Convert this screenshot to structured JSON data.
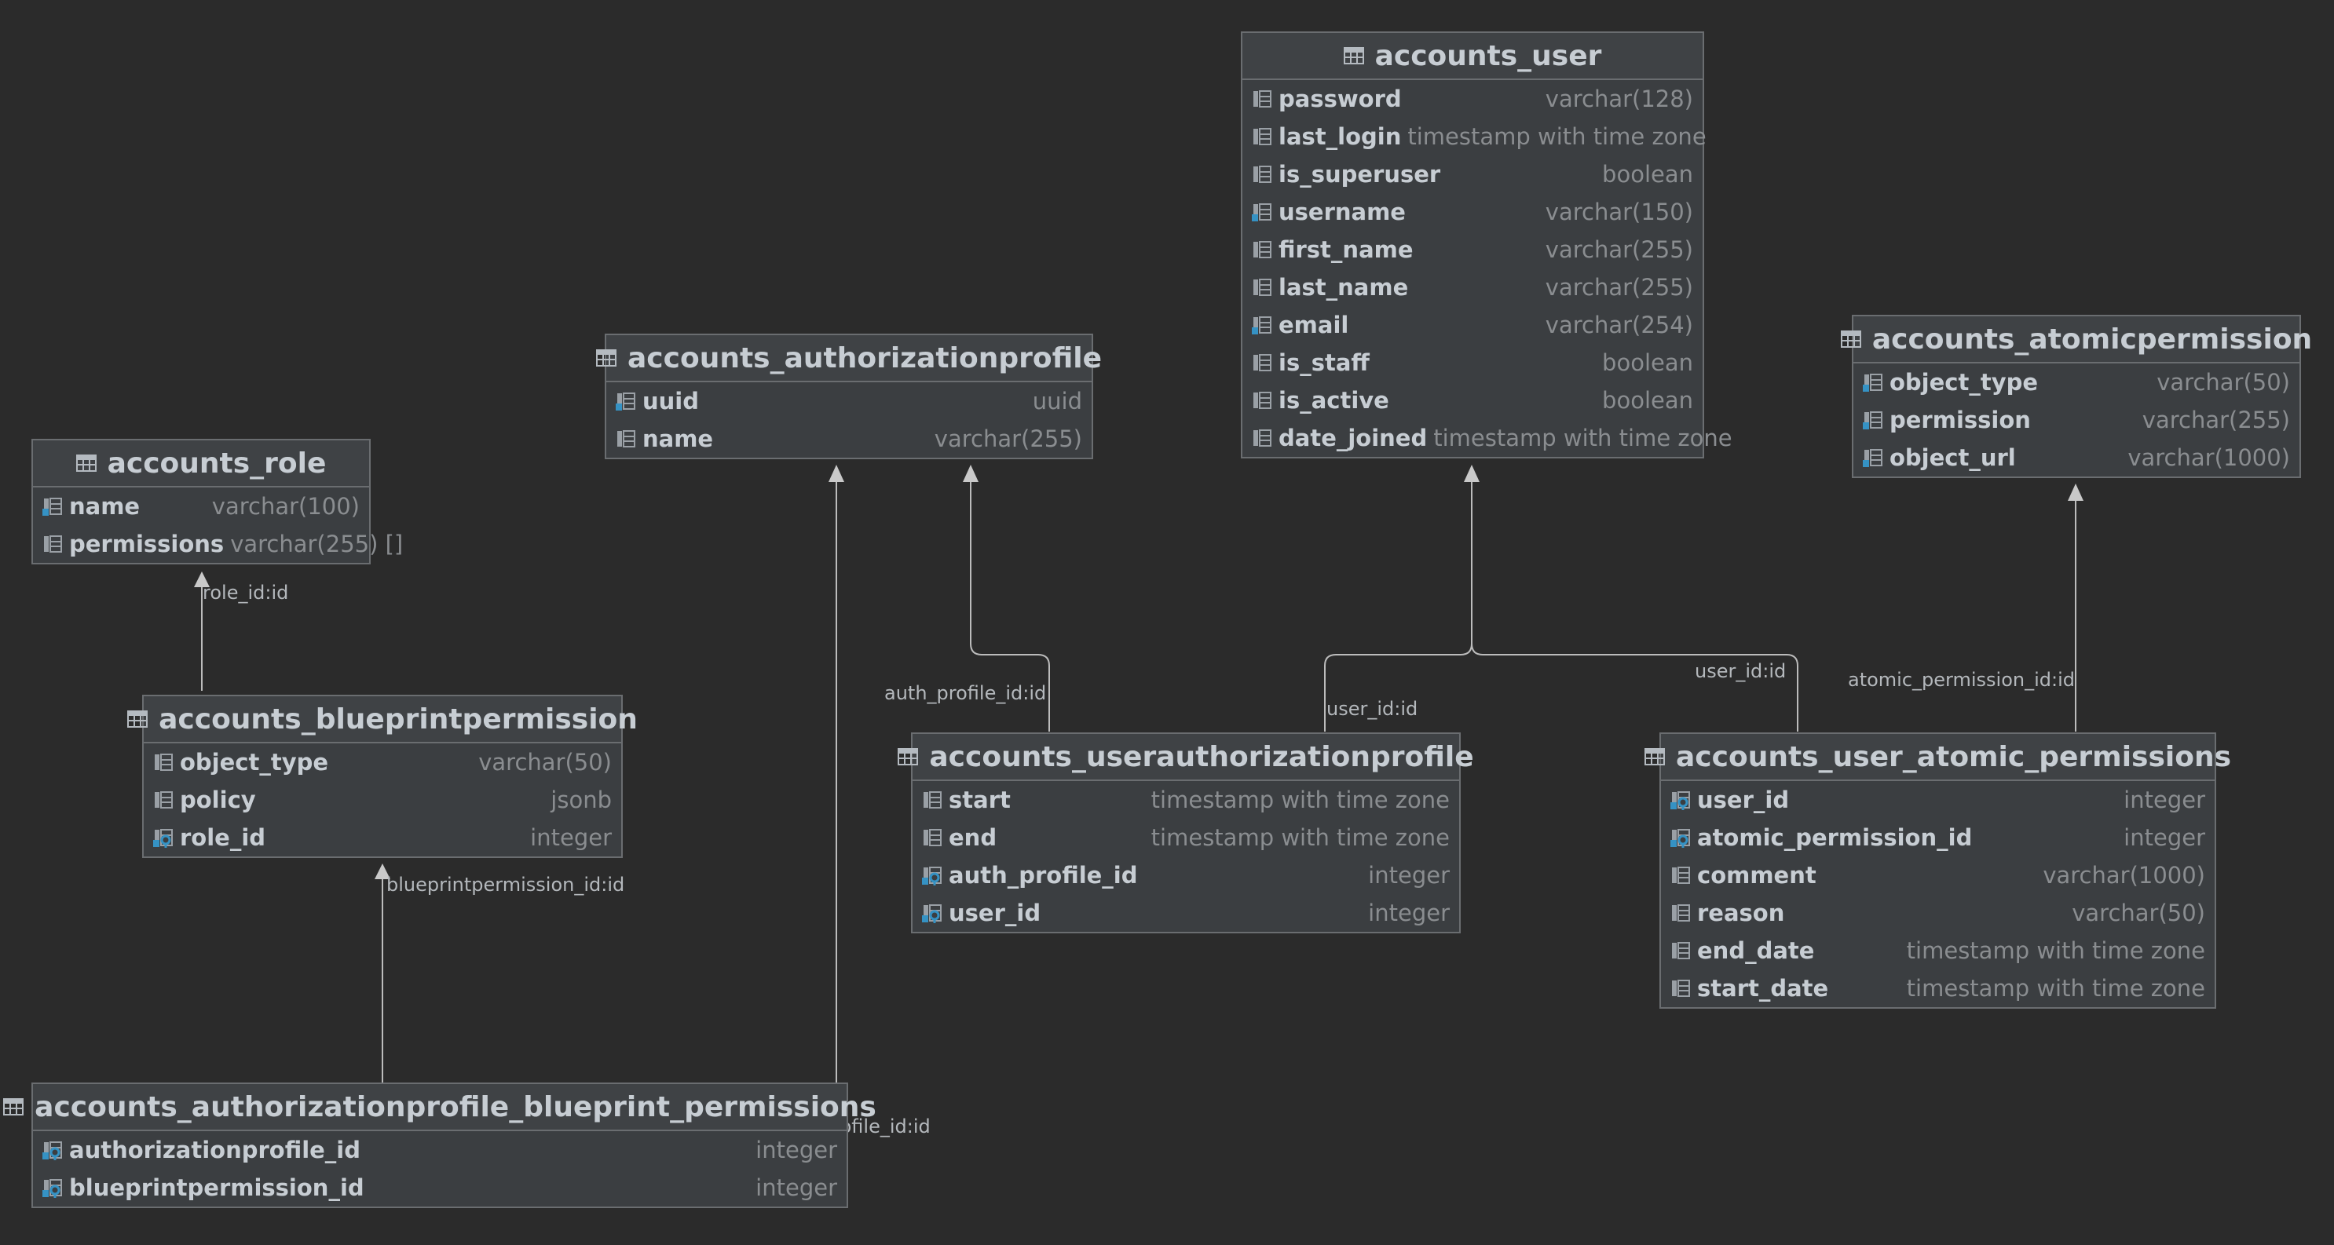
{
  "tables": {
    "accounts_user": {
      "title": "accounts_user",
      "columns": [
        {
          "name": "password",
          "type": "varchar(128)",
          "icon": "column-icon"
        },
        {
          "name": "last_login",
          "type": "timestamp with time zone",
          "icon": "column-icon"
        },
        {
          "name": "is_superuser",
          "type": "boolean",
          "icon": "column-icon"
        },
        {
          "name": "username",
          "type": "varchar(150)",
          "icon": "unique-column-icon"
        },
        {
          "name": "first_name",
          "type": "varchar(255)",
          "icon": "column-icon"
        },
        {
          "name": "last_name",
          "type": "varchar(255)",
          "icon": "column-icon"
        },
        {
          "name": "email",
          "type": "varchar(254)",
          "icon": "unique-column-icon"
        },
        {
          "name": "is_staff",
          "type": "boolean",
          "icon": "column-icon"
        },
        {
          "name": "is_active",
          "type": "boolean",
          "icon": "column-icon"
        },
        {
          "name": "date_joined",
          "type": "timestamp with time zone",
          "icon": "column-icon"
        }
      ]
    },
    "accounts_authorizationprofile": {
      "title": "accounts_authorizationprofile",
      "columns": [
        {
          "name": "uuid",
          "type": "uuid",
          "icon": "unique-column-icon"
        },
        {
          "name": "name",
          "type": "varchar(255)",
          "icon": "column-icon"
        }
      ]
    },
    "accounts_atomicpermission": {
      "title": "accounts_atomicpermission",
      "columns": [
        {
          "name": "object_type",
          "type": "varchar(50)",
          "icon": "unique-column-icon"
        },
        {
          "name": "permission",
          "type": "varchar(255)",
          "icon": "unique-column-icon"
        },
        {
          "name": "object_url",
          "type": "varchar(1000)",
          "icon": "unique-column-icon"
        }
      ]
    },
    "accounts_role": {
      "title": "accounts_role",
      "columns": [
        {
          "name": "name",
          "type": "varchar(100)",
          "icon": "unique-column-icon"
        },
        {
          "name": "permissions",
          "type": "varchar(255) []",
          "icon": "column-icon"
        }
      ]
    },
    "accounts_blueprintpermission": {
      "title": "accounts_blueprintpermission",
      "columns": [
        {
          "name": "object_type",
          "type": "varchar(50)",
          "icon": "column-icon"
        },
        {
          "name": "policy",
          "type": "jsonb",
          "icon": "column-icon"
        },
        {
          "name": "role_id",
          "type": "integer",
          "icon": "foreign-key-icon"
        }
      ]
    },
    "accounts_userauthorizationprofile": {
      "title": "accounts_userauthorizationprofile",
      "columns": [
        {
          "name": "start",
          "type": "timestamp with time zone",
          "icon": "column-icon"
        },
        {
          "name": "end",
          "type": "timestamp with time zone",
          "icon": "column-icon"
        },
        {
          "name": "auth_profile_id",
          "type": "integer",
          "icon": "foreign-key-icon"
        },
        {
          "name": "user_id",
          "type": "integer",
          "icon": "foreign-key-icon"
        }
      ]
    },
    "accounts_user_atomic_permissions": {
      "title": "accounts_user_atomic_permissions",
      "columns": [
        {
          "name": "user_id",
          "type": "integer",
          "icon": "foreign-key-icon"
        },
        {
          "name": "atomic_permission_id",
          "type": "integer",
          "icon": "foreign-key-icon"
        },
        {
          "name": "comment",
          "type": "varchar(1000)",
          "icon": "column-icon"
        },
        {
          "name": "reason",
          "type": "varchar(50)",
          "icon": "column-icon"
        },
        {
          "name": "end_date",
          "type": "timestamp with time zone",
          "icon": "column-icon"
        },
        {
          "name": "start_date",
          "type": "timestamp with time zone",
          "icon": "column-icon"
        }
      ]
    },
    "accounts_authorizationprofile_blueprint_permissions": {
      "title": "accounts_authorizationprofile_blueprint_permissions",
      "columns": [
        {
          "name": "authorizationprofile_id",
          "type": "integer",
          "icon": "foreign-key-icon"
        },
        {
          "name": "blueprintpermission_id",
          "type": "integer",
          "icon": "foreign-key-icon"
        }
      ]
    }
  },
  "relations": [
    {
      "label": "role_id:id"
    },
    {
      "label": "blueprintpermission_id:id"
    },
    {
      "label": "authorizationprofile_id:id"
    },
    {
      "label": "auth_profile_id:id"
    },
    {
      "label": "user_id:id"
    },
    {
      "label": "user_id:id"
    },
    {
      "label": "atomic_permission_id:id"
    }
  ],
  "colors": {
    "background": "#2b2b2b",
    "table_fill": "#3b3e41",
    "table_border": "#6a6d70",
    "title_text": "#c7cdd3",
    "type_text": "#8a8d90",
    "key_accent": "#3592c4",
    "edge": "#bcbcbc"
  }
}
